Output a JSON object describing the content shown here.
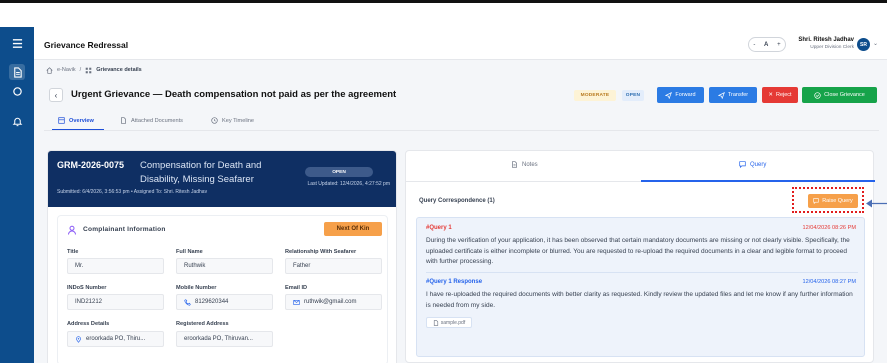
{
  "header": {
    "app_title": "Grievance Redressal",
    "font_minus": "-",
    "font_label": "A",
    "font_plus": "+",
    "user_name": "Shri. Ritesh Jadhav",
    "user_role": "Upper Division Clerk",
    "avatar_initials": "SR"
  },
  "breadcrumb": {
    "home": "e-Navik",
    "sep": "/",
    "current": "Grievance details"
  },
  "grievance": {
    "title": "Urgent Grievance — Death compensation not paid as per the agreement",
    "priority": "MODERATE",
    "status": "OPEN",
    "actions": {
      "forward": "Forward",
      "transfer": "Transfer",
      "reject": "Reject",
      "close": "Close Grievance"
    }
  },
  "tabs": [
    "Overview",
    "Attached Documents",
    "Key Timeline"
  ],
  "summary": {
    "id": "GRM-2026-0075",
    "subject_line1": "Compensation for Death and",
    "subject_line2": "Disability, Missing Seafarer",
    "meta": "Submitted: 6/4/2026, 3:56:53 pm  •  Assigned To: Shri. Ritesh Jadhav",
    "status": "OPEN",
    "last_updated": "Last Updated: 12/4/2026, 4:27:52 pm"
  },
  "complainant": {
    "section_title": "Complainant Information",
    "relationship_badge": "Next Of Kin",
    "fields": {
      "title_label": "Title",
      "title_value": "Mr.",
      "full_name_label": "Full Name",
      "full_name_value": "Ruthwik",
      "relationship_label": "Relationship With Seafarer",
      "relationship_value": "Father",
      "indos_label": "INDoS Number",
      "indos_value": "IND21212",
      "mobile_label": "Mobile Number",
      "mobile_value": "8129620344",
      "email_label": "Email ID",
      "email_value": "ruthwik@gmail.com",
      "address_label": "Address Details",
      "address_value": "eroorkada PO, Thiru...",
      "reg_address_label": "Registered Address",
      "reg_address_value": "eroorkada PO, Thiruvan..."
    }
  },
  "query_panel": {
    "tab_notes": "Notes",
    "tab_query": "Query",
    "correspondence_title": "Query Correspondence (1)",
    "raise_button": "Raise Query",
    "query": {
      "tag": "#Query 1",
      "time": "12/04/2026 08:26 PM",
      "text": "During the verification of your application, it has been observed that certain mandatory documents are missing or not clearly visible. Specifically, the uploaded certificate is either incomplete or blurred. You are requested to re-upload the required documents in a clear and legible format to proceed with further processing."
    },
    "response": {
      "tag": "#Query 1 Response",
      "time": "12/04/2026 08:27 PM",
      "text": "I have re-uploaded the required documents with better clarity as requested. Kindly review the updated files and let me know if any further information is needed from my side.",
      "attachment": "sample.pdf"
    }
  },
  "colors": {
    "sidebar": "#0d4d8c",
    "banner": "#0f2f63",
    "primary": "#2b7be4",
    "reject": "#e53935",
    "close": "#16a34a",
    "accent_orange": "#f6a04a",
    "query_tag": "#e53935",
    "response_tag": "#2563eb",
    "annotation_red": "#e11d1d"
  }
}
